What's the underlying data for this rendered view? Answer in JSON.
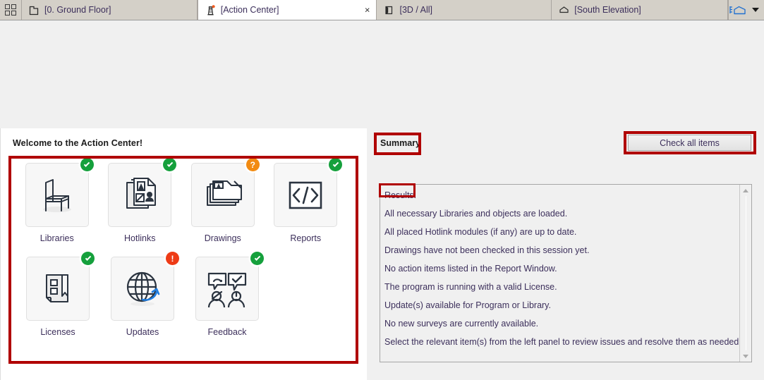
{
  "tabbar": {
    "grid_button": "view-grid",
    "tabs": [
      {
        "label": "[0. Ground Floor]",
        "icon": "floor-plan-icon",
        "active": false,
        "closable": false
      },
      {
        "label": "[Action Center]",
        "icon": "lighthouse-icon",
        "active": true,
        "closable": true,
        "close_label": "×",
        "badge": "alert-dot"
      },
      {
        "label": "[3D / All]",
        "icon": "cube-3d-icon",
        "active": false,
        "closable": false
      },
      {
        "label": "[South Elevation]",
        "icon": "elevation-house-icon",
        "active": false,
        "closable": false
      }
    ],
    "right_tool": {
      "icon": "elevation-marker-icon",
      "dropdown": "chevron-down-icon"
    }
  },
  "left_panel": {
    "welcome": "Welcome to the Action Center!",
    "tiles": [
      {
        "label": "Libraries",
        "icon": "chair-icon",
        "status": "ok",
        "status_glyph": "check"
      },
      {
        "label": "Hotlinks",
        "icon": "documents-icon",
        "status": "ok",
        "status_glyph": "check"
      },
      {
        "label": "Drawings",
        "icon": "drawing-file-icon",
        "status": "warn",
        "status_glyph": "?"
      },
      {
        "label": "Reports",
        "icon": "code-brackets-icon",
        "status": "ok",
        "status_glyph": "check"
      },
      {
        "label": "Licenses",
        "icon": "license-book-icon",
        "status": "ok",
        "status_glyph": "check"
      },
      {
        "label": "Updates",
        "icon": "globe-refresh-icon",
        "status": "err",
        "status_glyph": "!"
      },
      {
        "label": "Feedback",
        "icon": "feedback-chat-icon",
        "status": "ok",
        "status_glyph": "check"
      }
    ]
  },
  "right_panel": {
    "summary_label": "Summary",
    "check_all_button": "Check all items",
    "results_title": "Results:",
    "results": [
      "All necessary Libraries and objects are loaded.",
      "All placed Hotlink modules (if any) are up to date.",
      "Drawings have not been checked in this session yet.",
      "No action items listed in the Report Window.",
      "The program is running with a valid License.",
      "Update(s) available for Program or Library.",
      "No new surveys are currently available.",
      "Select the relevant item(s) from the left panel to review issues and resolve them as needed."
    ],
    "scrollbar": {
      "up": "scroll-up-icon",
      "down": "scroll-down-icon"
    }
  },
  "annotations": {
    "color": "#b00000",
    "boxes": [
      "tiles-group",
      "summary-label",
      "check-all-button",
      "results-label"
    ]
  }
}
